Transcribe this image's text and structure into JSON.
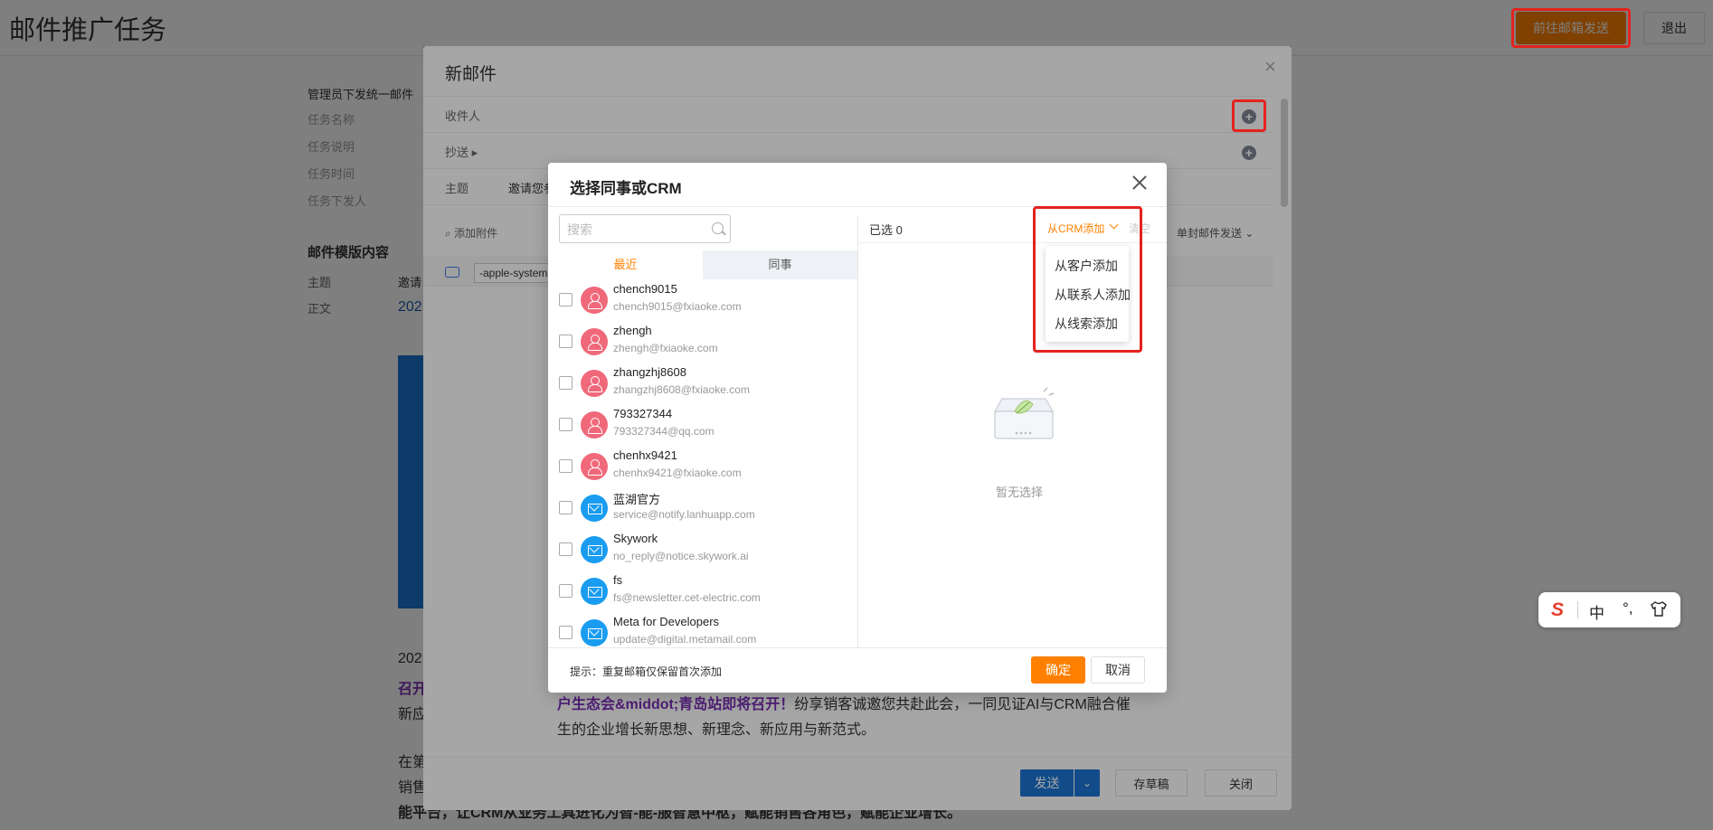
{
  "page": {
    "title": "邮件推广任务",
    "goto_send_label": "前往邮箱发送",
    "exit_label": "退出"
  },
  "task_info": {
    "heading": "管理员下发统一邮件",
    "rows": [
      {
        "label": "任务名称"
      },
      {
        "label": "任务说明"
      },
      {
        "label": "任务时间"
      },
      {
        "label": "任务下发人"
      }
    ]
  },
  "template": {
    "title": "邮件模版内容",
    "subject_label": "主题",
    "subject_value": "邀请",
    "body_label": "正文",
    "body_value": "202",
    "link_text": "2025城市客户生",
    "para1": "202",
    "para2": "召开",
    "para3": "新应",
    "para4": "在第",
    "para5": "销售",
    "para6": "能平台，让CRM从业务工具进化为智-能-服智慧中枢，赋能销售各角色，赋能企业增长。"
  },
  "compose": {
    "title": "新邮件",
    "recipient_label": "收件人",
    "cc_label": "抄送",
    "subject_label": "主题",
    "subject_value": "邀请您参",
    "attach_label": "添加附件",
    "send_mode_label": "单封邮件发送",
    "font_select": "-apple-system",
    "body_line1": "户生态会&middot;青岛站即将召开！",
    "body_line1_rest": "纷享销客诚邀您共赴此会，一同见证AI与CRM融合催",
    "body_line2": "生的企业增长新思想、新理念、新应用与新范式。",
    "send_label": "发送",
    "draft_label": "存草稿",
    "close_label": "关闭"
  },
  "dialog": {
    "title": "选择同事或CRM",
    "search_placeholder": "搜索",
    "tabs": [
      {
        "label": "最近",
        "active": true
      },
      {
        "label": "同事",
        "active": false
      }
    ],
    "contacts": [
      {
        "name": "chench9015",
        "email": "chench9015@fxiaoke.com",
        "type": "person"
      },
      {
        "name": "zhengh",
        "email": "zhengh@fxiaoke.com",
        "type": "person"
      },
      {
        "name": "zhangzhj8608",
        "email": "zhangzhj8608@fxiaoke.com",
        "type": "person"
      },
      {
        "name": "793327344",
        "email": "793327344@qq.com",
        "type": "person"
      },
      {
        "name": "chenhx9421",
        "email": "chenhx9421@fxiaoke.com",
        "type": "person"
      },
      {
        "name": "蓝湖官方",
        "email": "service@notify.lanhuapp.com",
        "type": "mail"
      },
      {
        "name": "Skywork",
        "email": "no_reply@notice.skywork.ai",
        "type": "mail"
      },
      {
        "name": "fs",
        "email": "fs@newsletter.cet-electric.com",
        "type": "mail"
      },
      {
        "name": "Meta for Developers",
        "email": "update@digital.metamail.com",
        "type": "mail"
      }
    ],
    "selected_count_label": "已选 0",
    "crm_add_label": "从CRM添加",
    "clear_label": "清空",
    "crm_menu": [
      "从客户添加",
      "从联系人添加",
      "从线索添加"
    ],
    "empty_text": "暂无选择",
    "hint": "提示：重复邮箱仅保留首次添加",
    "confirm_label": "确定",
    "cancel_label": "取消"
  },
  "ime": {
    "lang": "中",
    "punct": "°,"
  },
  "colors": {
    "accent": "#ff8000",
    "primary": "#1b74d3",
    "highlight_frame": "#e3231f"
  }
}
